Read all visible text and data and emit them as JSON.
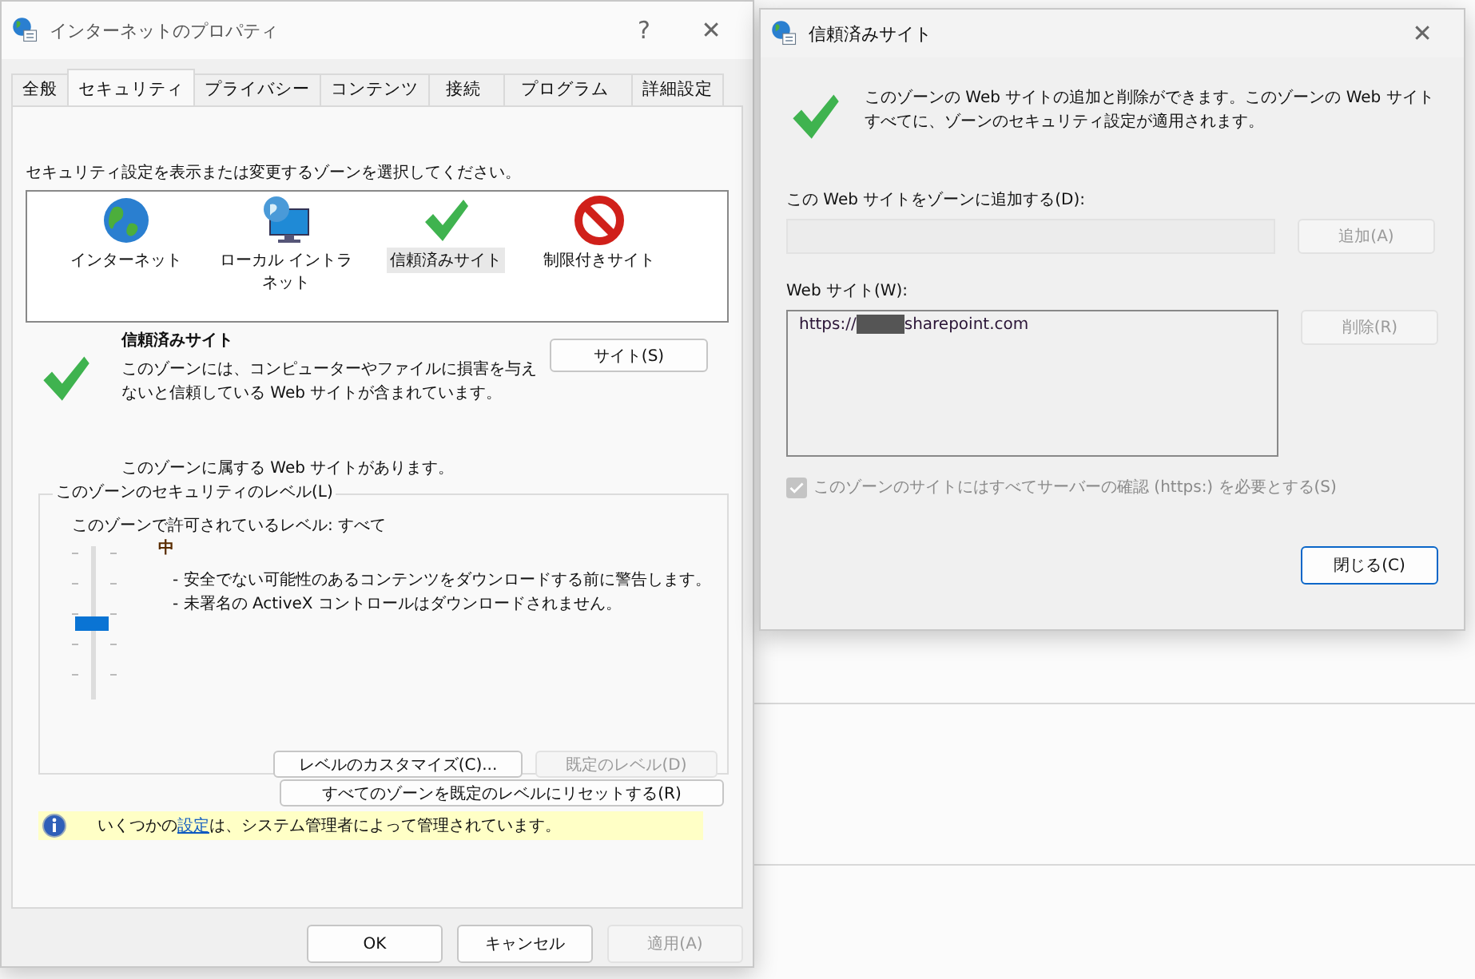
{
  "main_window": {
    "title": "インターネットのプロパティ",
    "help_glyph": "?",
    "close_glyph": "✕",
    "tabs": [
      {
        "label": "全般",
        "selected": false
      },
      {
        "label": "セキュリティ",
        "selected": true
      },
      {
        "label": "プライバシー",
        "selected": false
      },
      {
        "label": "コンテンツ",
        "selected": false
      },
      {
        "label": "接続",
        "selected": false
      },
      {
        "label": "プログラム",
        "selected": false
      },
      {
        "label": "詳細設定",
        "selected": false
      }
    ],
    "zone_prompt": "セキュリティ設定を表示または変更するゾーンを選択してください。",
    "zones": [
      {
        "name": "インターネット",
        "kind": "globe",
        "selected": false
      },
      {
        "name": "ローカル イントラネット",
        "kind": "intranet",
        "selected": false
      },
      {
        "name": "信頼済みサイト",
        "kind": "check",
        "selected": true
      },
      {
        "name": "制限付きサイト",
        "kind": "forbidden",
        "selected": false
      }
    ],
    "zone_title": "信頼済みサイト",
    "zone_description": "このゾーンには、コンピューターやファイルに損害を与えないと信頼している Web サイトが含まれています。",
    "sites_button": "サイト(S)",
    "zone_note": "このゾーンに属する Web サイトがあります。",
    "level_group": {
      "legend": "このゾーンのセキュリティのレベル(L)",
      "allowed": "このゾーンで許可されているレベル: すべて",
      "slider": {
        "level": 0.5
      },
      "level_name": "中",
      "points": [
        "- 安全でない可能性のあるコンテンツをダウンロードする前に警告します。",
        "- 未署名の ActiveX コントロールはダウンロードされません。"
      ],
      "buttons": [
        {
          "label": "レベルのカスタマイズ(C)...",
          "disabled": false
        },
        {
          "label": "既定のレベル(D)",
          "disabled": true
        }
      ]
    },
    "reset_button": "すべてのゾーンを既定のレベルにリセットする(R)",
    "info": {
      "before": "いくつかの",
      "link": "設定",
      "after": "は、システム管理者によって管理されています。"
    },
    "footer_buttons": [
      {
        "label": "OK",
        "disabled": false
      },
      {
        "label": "キャンセル",
        "disabled": false
      },
      {
        "label": "適用(A)",
        "disabled": true
      }
    ]
  },
  "sites_window": {
    "title": "信頼済みサイト",
    "close_glyph": "✕",
    "description": "このゾーンの Web サイトの追加と削除ができます。このゾーンの Web サイトすべてに、ゾーンのセキュリティ設定が適用されます。",
    "add_label": "この Web サイトをゾーンに追加する(D):",
    "add_button": {
      "label": "追加(A)",
      "disabled": true
    },
    "list_label": "Web サイト(W):",
    "sites": [
      {
        "prefix": "https://",
        "redacted": true,
        "suffix": "sharepoint.com"
      }
    ],
    "remove_button": {
      "label": "削除(R)",
      "disabled": true
    },
    "require_https": {
      "label": "このゾーンのサイトにはすべてサーバーの確認 (https:) を必要とする(S)",
      "checked": true,
      "disabled": true
    },
    "close_button": {
      "label": "閉じる(C)",
      "disabled": false
    }
  }
}
